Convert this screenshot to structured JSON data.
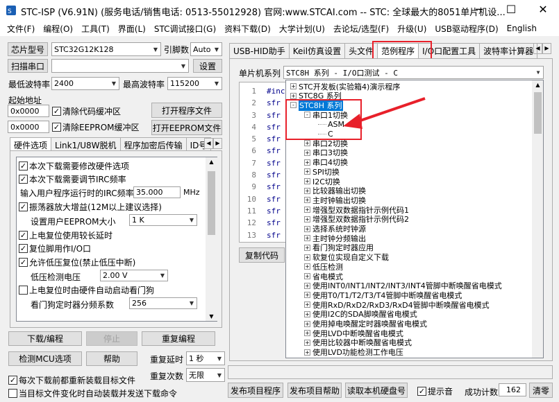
{
  "window": {
    "title": "STC-ISP (V6.91N) (服务电话/销售电话: 0513-55012928) 官网:www.STCAI.com  -- STC: 全球最大的8051单片机设..."
  },
  "menu": [
    "文件(F)",
    "编程(O)",
    "工具(T)",
    "界面(L)",
    "STC调试接口(G)",
    "资料下载(D)",
    "大学计划(U)",
    "去论坛/选型(F)",
    "升级(U)",
    "USB驱动程序(D)",
    "English"
  ],
  "left": {
    "chip_label": "芯片型号",
    "chip_value": "STC32G12K128",
    "pins_label": "引脚数",
    "pins_value": "Auto",
    "scan_label": "扫描串口",
    "settings_label": "设置",
    "min_baud_label": "最低波特率",
    "min_baud": "2400",
    "max_baud_label": "最高波特率",
    "max_baud": "115200",
    "start_addr_label": "起始地址",
    "addr1": "0x0000",
    "addr2": "0x0000",
    "clear_code": "清除代码缓冲区",
    "clear_eeprom": "清除EEPROM缓冲区",
    "open_prog": "打开程序文件",
    "open_eeprom": "打开EEPROM文件",
    "tabs": [
      "硬件选项",
      "Link1/U8W脱机",
      "程序加密后传输",
      "ID号"
    ],
    "options": {
      "modify_hw": "本次下载需要修改硬件选项",
      "adjust_irc": "本次下载需要调节IRC频率",
      "irc_label": "输入用户程序运行时的IRC频率",
      "irc_value": "35.000",
      "irc_unit": "MHz",
      "osc_gain": "振荡器放大增益(12M以上建议选择)",
      "eeprom_size_label": "设置用户EEPROM大小",
      "eeprom_size": "1   K",
      "power_reset": "上电复位使用较长延时",
      "reset_pin": "复位脚用作I/O口",
      "lvr": "允许低压复位(禁止低压中断)",
      "lvd_label": "低压检测电压",
      "lvd_value": "2.00 V",
      "wdt_auto": "上电复位时由硬件自动启动看门狗",
      "wdt_div_label": "看门狗定时器分频系数",
      "wdt_div": "256"
    },
    "download": "下载/编程",
    "stop": "停止",
    "reprogram": "重复编程",
    "detect_mcu": "检测MCU选项",
    "help": "帮助",
    "repeat_delay_label": "重复延时",
    "repeat_delay": "1 秒",
    "repeat_count_label": "重复次数",
    "repeat_count": "无限",
    "reload_each": "每次下载前都重新装载目标文件",
    "auto_load": "当目标文件变化时自动装载并发送下载命令"
  },
  "right": {
    "tabs": [
      "USB-HID助手",
      "Keil仿真设置",
      "头文件",
      "范例程序",
      "I/O口配置工具",
      "波特率计算器"
    ],
    "mcu_series_label": "单片机系列",
    "mcu_series_value": "STC8H 系列 - I/O口测试 - C",
    "code_lines": [
      "#inc",
      "sfr",
      "sfr",
      "sfr",
      "sfr",
      "sfr",
      "sfr",
      "sfr",
      "sfr",
      "sfr",
      "sfr",
      "sfr",
      "sfr"
    ],
    "line_numbers": [
      "1",
      "2",
      "3",
      "4",
      "5",
      "6",
      "7",
      "8",
      "9",
      "10",
      "11",
      "12",
      "13"
    ],
    "copy_code": "复制代码",
    "tree": [
      {
        "label": "STC开发板(实验箱4)演示程序",
        "level": 0,
        "pm": "+"
      },
      {
        "label": "STC8G 系列",
        "level": 0,
        "pm": "+"
      },
      {
        "label": "STC8H 系列",
        "level": 0,
        "pm": "-"
      },
      {
        "label": "串口1切换",
        "level": 1,
        "pm": "-"
      },
      {
        "label": "ASM",
        "level": 2,
        "pm": ""
      },
      {
        "label": "C",
        "level": 2,
        "pm": ""
      },
      {
        "label": "串口2切换",
        "level": 1,
        "pm": "+"
      },
      {
        "label": "串口3切换",
        "level": 1,
        "pm": "+"
      },
      {
        "label": "串口4切换",
        "level": 1,
        "pm": "+"
      },
      {
        "label": "SPI切换",
        "level": 1,
        "pm": "+"
      },
      {
        "label": "I2C切换",
        "level": 1,
        "pm": "+"
      },
      {
        "label": "比较器输出切换",
        "level": 1,
        "pm": "+"
      },
      {
        "label": "主时钟输出切换",
        "level": 1,
        "pm": "+"
      },
      {
        "label": "增强型双数据指针示例代码1",
        "level": 1,
        "pm": "+"
      },
      {
        "label": "增强型双数据指针示例代码2",
        "level": 1,
        "pm": "+"
      },
      {
        "label": "选择系统时钟源",
        "level": 1,
        "pm": "+"
      },
      {
        "label": "主时钟分频输出",
        "level": 1,
        "pm": "+"
      },
      {
        "label": "看门狗定时器应用",
        "level": 1,
        "pm": "+"
      },
      {
        "label": "软复位实现自定义下载",
        "level": 1,
        "pm": "+"
      },
      {
        "label": "低压检测",
        "level": 1,
        "pm": "+"
      },
      {
        "label": "省电模式",
        "level": 1,
        "pm": "+"
      },
      {
        "label": "使用INT0/INT1/INT2/INT3/INT4管脚中断唤醒省电模式",
        "level": 1,
        "pm": "+"
      },
      {
        "label": "使用T0/T1/T2/T3/T4管脚中断唤醒省电模式",
        "level": 1,
        "pm": "+"
      },
      {
        "label": "使用RxD/RxD2/RxD3/RxD4管脚中断唤醒省电模式",
        "level": 1,
        "pm": "+"
      },
      {
        "label": "使用I2C的SDA脚唤醒省电模式",
        "level": 1,
        "pm": "+"
      },
      {
        "label": "使用掉电唤醒定时器唤醒省电模式",
        "level": 1,
        "pm": "+"
      },
      {
        "label": "使用LVD中断唤醒省电模式",
        "level": 1,
        "pm": "+"
      },
      {
        "label": "使用比较器中断唤醒省电模式",
        "level": 1,
        "pm": "+"
      },
      {
        "label": "使用LVD功能检测工作电压",
        "level": 1,
        "pm": "+"
      }
    ],
    "publish_prog": "发布项目程序",
    "publish_help": "发布项目帮助",
    "read_disk": "读取本机硬盘号",
    "beep": "提示音",
    "success_label": "成功计数",
    "success_count": "162",
    "clear": "清零"
  },
  "colors": {
    "accent": "#e8202a",
    "selection": "#0078d7"
  }
}
